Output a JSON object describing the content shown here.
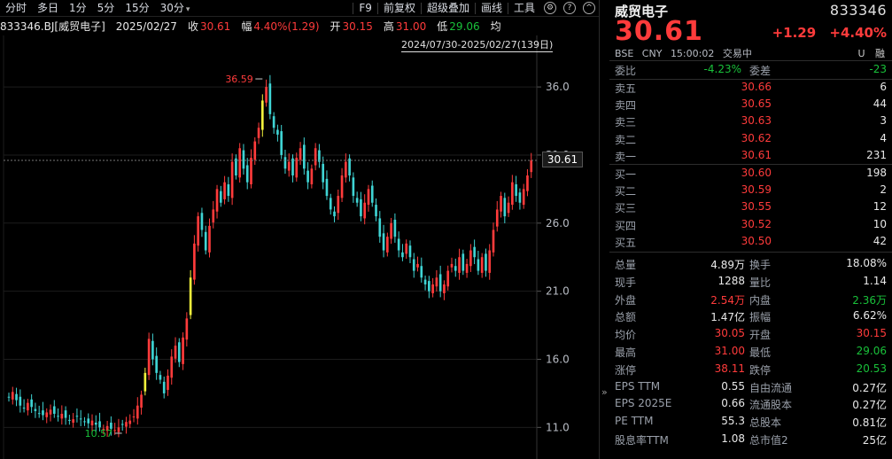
{
  "toolbar": {
    "left_items": [
      "分时",
      "多日",
      "1分",
      "5分",
      "15分",
      "30分"
    ],
    "right_items": [
      "F9",
      "前复权",
      "超级叠加",
      "画线",
      "工具"
    ]
  },
  "infobar": {
    "code_name": "833346.BJ[威贸电子]",
    "date": "2025/02/27",
    "close_label": "收",
    "close": "30.61",
    "amp_label": "幅",
    "amp": "4.40%(1.29)",
    "open_label": "开",
    "open": "30.15",
    "high_label": "高",
    "high": "31.00",
    "low_label": "低",
    "low": "29.06",
    "avg_label": "均"
  },
  "range_label": "2024/07/30-2025/02/27(139日)",
  "current_price_tag": "30.61",
  "chart_data": {
    "type": "candlestick",
    "y_ticks": [
      36.0,
      31.0,
      26.0,
      21.0,
      16.0,
      11.0
    ],
    "ylim": [
      9.2,
      39.0
    ],
    "high_label": "36.59",
    "low_label": "10.57",
    "colors": {
      "up": "#ff3b3b",
      "down": "#3fd4d4",
      "flat": "#f0f03c"
    }
  },
  "panel": {
    "name": "威贸电子",
    "code": "833346",
    "price": "30.61",
    "change": "+1.29",
    "change_pct": "+4.40%",
    "exchange": "BSE",
    "currency": "CNY",
    "time": "15:00:02",
    "status": "交易中",
    "flags": [
      "U",
      "融"
    ],
    "weibi_label": "委比",
    "weibi": "-4.23%",
    "weicha_label": "委差",
    "weicha": "-23",
    "asks": [
      {
        "label": "卖五",
        "price": "30.66",
        "vol": "6"
      },
      {
        "label": "卖四",
        "price": "30.65",
        "vol": "44"
      },
      {
        "label": "卖三",
        "price": "30.63",
        "vol": "3"
      },
      {
        "label": "卖二",
        "price": "30.62",
        "vol": "4"
      },
      {
        "label": "卖一",
        "price": "30.61",
        "vol": "231"
      }
    ],
    "bids": [
      {
        "label": "买一",
        "price": "30.60",
        "vol": "198"
      },
      {
        "label": "买二",
        "price": "30.59",
        "vol": "2"
      },
      {
        "label": "买三",
        "price": "30.55",
        "vol": "12"
      },
      {
        "label": "买四",
        "price": "30.52",
        "vol": "10"
      },
      {
        "label": "买五",
        "price": "30.50",
        "vol": "42"
      }
    ],
    "stats": [
      {
        "l1": "总量",
        "v1": "4.89万",
        "c1": "white",
        "l2": "换手",
        "v2": "18.08%",
        "c2": "white"
      },
      {
        "l1": "现手",
        "v1": "1288",
        "c1": "white",
        "l2": "量比",
        "v2": "1.14",
        "c2": "white"
      },
      {
        "l1": "外盘",
        "v1": "2.54万",
        "c1": "red",
        "l2": "内盘",
        "v2": "2.36万",
        "c2": "green"
      },
      {
        "l1": "总额",
        "v1": "1.47亿",
        "c1": "white",
        "l2": "振幅",
        "v2": "6.62%",
        "c2": "white"
      },
      {
        "l1": "均价",
        "v1": "30.05",
        "c1": "red",
        "l2": "开盘",
        "v2": "30.15",
        "c2": "red"
      },
      {
        "l1": "最高",
        "v1": "31.00",
        "c1": "red",
        "l2": "最低",
        "v2": "29.06",
        "c2": "green"
      },
      {
        "l1": "涨停",
        "v1": "38.11",
        "c1": "red",
        "l2": "跌停",
        "v2": "20.53",
        "c2": "green"
      },
      {
        "l1": "EPS TTM",
        "v1": "0.55",
        "c1": "white",
        "l2": "自由流通",
        "v2": "0.27亿",
        "c2": "white"
      },
      {
        "l1": "EPS 2025E",
        "v1": "0.66",
        "c1": "white",
        "l2": "流通股本",
        "v2": "0.27亿",
        "c2": "white"
      },
      {
        "l1": "PE TTM",
        "v1": "55.3",
        "c1": "white",
        "l2": "总股本",
        "v2": "0.81亿",
        "c2": "white"
      },
      {
        "l1": "股息率TTM",
        "v1": "1.08",
        "c1": "white",
        "l2": "总市值2",
        "v2": "25亿",
        "c2": "white"
      }
    ]
  }
}
